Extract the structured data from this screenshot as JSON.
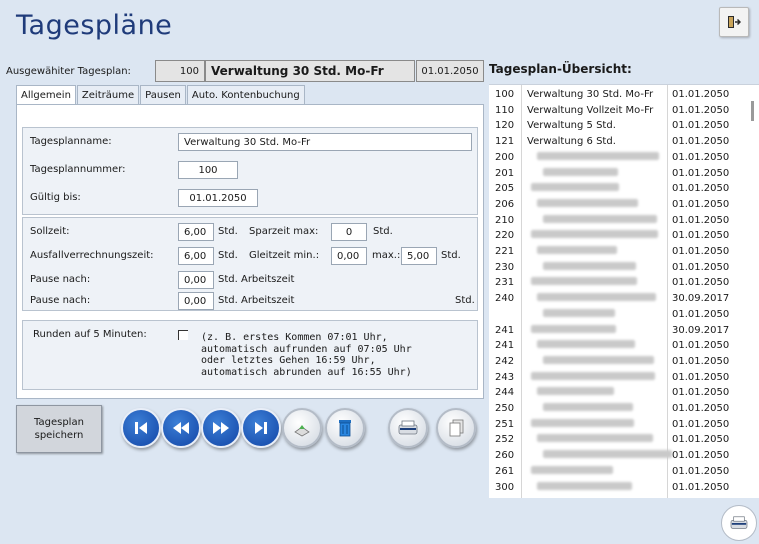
{
  "header": {
    "title": "Tagespläne",
    "exit_icon": "exit-door-icon"
  },
  "selection": {
    "label": "Ausgewähiter Tagesplan:",
    "number": "100",
    "name": "Verwaltung 30 Std. Mo-Fr",
    "date": "01.01.2050"
  },
  "overview": {
    "title": "Tagesplan-Übersicht:"
  },
  "tabs": [
    {
      "label": "Allgemein",
      "active": true
    },
    {
      "label": "Zeiträume"
    },
    {
      "label": "Pausen"
    },
    {
      "label": "Auto. Kontenbuchung"
    }
  ],
  "general": {
    "name_label": "Tagesplanname:",
    "name_value": "Verwaltung 30 Std. Mo-Fr",
    "number_label": "Tagesplannummer:",
    "number_value": "100",
    "valid_label": "Gültig bis:",
    "valid_value": "01.01.2050"
  },
  "times": {
    "sollzeit_label": "Sollzeit:",
    "sollzeit_value": "6,00",
    "std1": "Std.",
    "sparzeit_label": "Sparzeit max:",
    "sparzeit_value": "0",
    "std2": "Std.",
    "ausfall_label": "Ausfallverrechnungszeit:",
    "ausfall_value": "6,00",
    "std3": "Std.",
    "gleitzeit_label": "Gleitzeit min.:",
    "gleitzeit_min": "0,00",
    "max_label": "max.:",
    "gleitzeit_max": "5,00",
    "std4": "Std.",
    "pause1_label": "Pause nach:",
    "pause1_value": "0,00",
    "pause1_unit": "Std. Arbeitszeit",
    "pause2_label": "Pause nach:",
    "pause2_value": "0,00",
    "pause2_unit": "Std. Arbeitszeit",
    "std5": "Std."
  },
  "rounding": {
    "label": "Runden auf 5 Minuten:",
    "line1": "(z. B. erstes Kommen 07:01 Uhr,",
    "line2": "automatisch aufrunden auf 07:05 Uhr",
    "line3": "oder letztes Gehen 16:59 Uhr,",
    "line4": "automatisch abrunden auf 16:55 Uhr)"
  },
  "buttons": {
    "save_line1": "Tagesplan",
    "save_line2": "speichern"
  },
  "plan_list": [
    {
      "num": "100",
      "name": "Verwaltung 30 Std. Mo-Fr",
      "date": "01.01.2050"
    },
    {
      "num": "110",
      "name": "Verwaltung Vollzeit Mo-Fr",
      "date": "01.01.2050"
    },
    {
      "num": "120",
      "name": "Verwaltung 5 Std.",
      "date": "01.01.2050"
    },
    {
      "num": "121",
      "name": "Verwaltung 6 Std.",
      "date": "01.01.2050"
    },
    {
      "num": "200",
      "name": "",
      "date": "01.01.2050"
    },
    {
      "num": "201",
      "name": "",
      "date": "01.01.2050"
    },
    {
      "num": "205",
      "name": "",
      "date": "01.01.2050"
    },
    {
      "num": "206",
      "name": "",
      "date": "01.01.2050"
    },
    {
      "num": "210",
      "name": "",
      "date": "01.01.2050"
    },
    {
      "num": "220",
      "name": "",
      "date": "01.01.2050"
    },
    {
      "num": "221",
      "name": "",
      "date": "01.01.2050"
    },
    {
      "num": "230",
      "name": "",
      "date": "01.01.2050"
    },
    {
      "num": "231",
      "name": "",
      "date": "01.01.2050"
    },
    {
      "num": "240",
      "name": "",
      "date": "30.09.2017"
    },
    {
      "num": "",
      "name": "",
      "date": "01.01.2050"
    },
    {
      "num": "241",
      "name": "",
      "date": "30.09.2017"
    },
    {
      "num": "241",
      "name": "",
      "date": "01.01.2050"
    },
    {
      "num": "242",
      "name": "",
      "date": "01.01.2050"
    },
    {
      "num": "243",
      "name": "",
      "date": "01.01.2050"
    },
    {
      "num": "244",
      "name": "",
      "date": "01.01.2050"
    },
    {
      "num": "250",
      "name": "",
      "date": "01.01.2050"
    },
    {
      "num": "251",
      "name": "",
      "date": "01.01.2050"
    },
    {
      "num": "252",
      "name": "",
      "date": "01.01.2050"
    },
    {
      "num": "260",
      "name": "",
      "date": "01.01.2050"
    },
    {
      "num": "261",
      "name": "",
      "date": "01.01.2050"
    },
    {
      "num": "300",
      "name": "",
      "date": "01.01.2050"
    }
  ]
}
